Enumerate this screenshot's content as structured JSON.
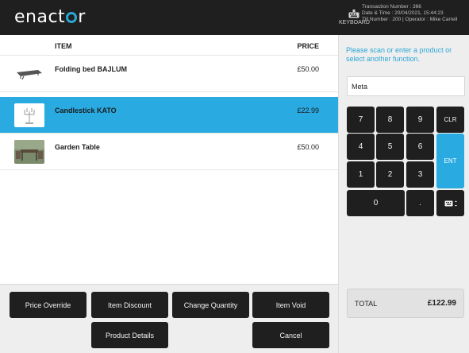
{
  "header": {
    "logo_before": "enact",
    "logo_after": "r",
    "keyboard_label": "KEYBOARD",
    "transaction_number": "Transaction Number : 366",
    "date_time": "Date & Time : 20/04/2021, 15:44:23",
    "till_operator": "Till Number : 200 | Operator : Mike Carrell"
  },
  "items": {
    "col_item": "ITEM",
    "col_price": "PRICE",
    "rows": [
      {
        "name": "Folding bed BAJLUM",
        "price": "£50.00",
        "selected": false
      },
      {
        "name": "Candlestick KATO",
        "price": "£22.99",
        "selected": true
      },
      {
        "name": "Garden Table",
        "price": "£50.00",
        "selected": false
      }
    ]
  },
  "actions": {
    "price_override": "Price Override",
    "item_discount": "Item Discount",
    "change_quantity": "Change Quantity",
    "item_void": "Item Void",
    "product_details": "Product Details",
    "cancel": "Cancel"
  },
  "right": {
    "prompt": "Please scan or enter a product or select another function.",
    "entry_value": "Meta",
    "keys": {
      "k7": "7",
      "k8": "8",
      "k9": "9",
      "clr": "CLR",
      "k4": "4",
      "k5": "5",
      "k6": "6",
      "ent": "ENT",
      "k1": "1",
      "k2": "2",
      "k3": "3",
      "k0": "0",
      "dot": "."
    },
    "total_label": "TOTAL",
    "total_value": "£122.99"
  },
  "colors": {
    "accent": "#29abe2",
    "dark": "#1f1f1f",
    "panel": "#eeeeee"
  }
}
